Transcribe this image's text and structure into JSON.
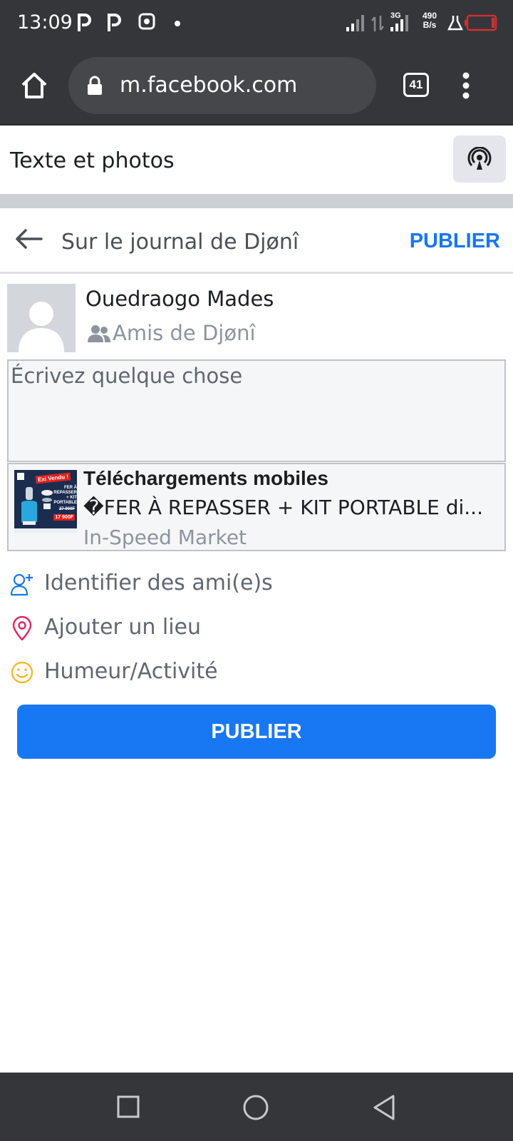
{
  "status_bar": {
    "time": "13:09",
    "network_type": "3G",
    "speed_value": "490",
    "speed_unit": "B/s"
  },
  "browser": {
    "url": "m.facebook.com",
    "tab_count": "41"
  },
  "text_photos": {
    "label": "Texte et photos"
  },
  "composer": {
    "title": "Sur le journal de Djønî",
    "publish_link": "PUBLIER"
  },
  "user": {
    "name": "Ouedraogo Mades",
    "audience": "Amis de Djønî"
  },
  "post": {
    "placeholder": "Écrivez quelque chose"
  },
  "link_preview": {
    "title": "Téléchargements mobiles",
    "description": "�FER À REPASSER + KIT PORTABLE di...",
    "source": "In-Speed Market",
    "thumb_badge": "Exi Vendu !",
    "thumb_text": "FER À REPASSER + KIT PORTABLE",
    "thumb_price_old": "27 900F",
    "thumb_price_new": "17 900F"
  },
  "actions": [
    {
      "label": "Identifier des ami(e)s",
      "icon": "tag-friends-icon"
    },
    {
      "label": "Ajouter un lieu",
      "icon": "location-pin-icon"
    },
    {
      "label": "Humeur/Activité",
      "icon": "smiley-icon"
    }
  ],
  "publish_button": {
    "label": "PUBLIER"
  },
  "colors": {
    "brand_blue": "#1877f2",
    "chrome_dark": "#35363a",
    "pin_pink": "#e0245e",
    "smiley_yellow": "#f7b928"
  }
}
